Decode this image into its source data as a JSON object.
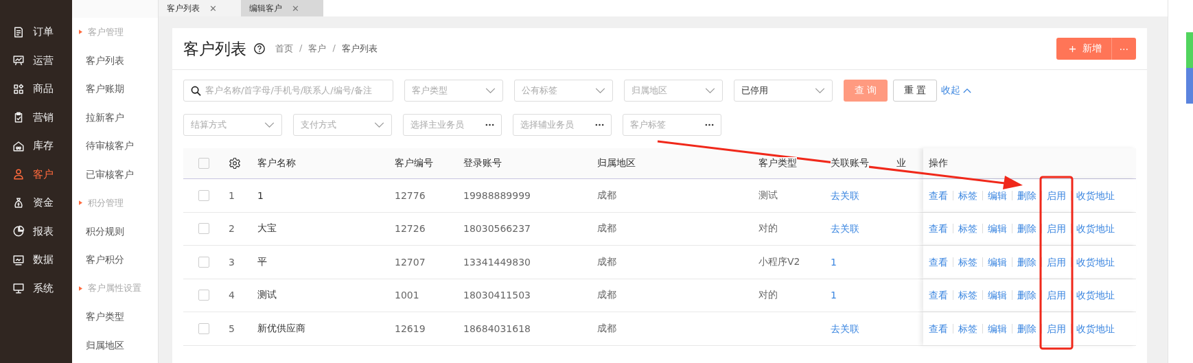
{
  "nav": [
    {
      "label": "订单",
      "selected": false
    },
    {
      "label": "运营",
      "selected": false
    },
    {
      "label": "商品",
      "selected": false
    },
    {
      "label": "营销",
      "selected": false
    },
    {
      "label": "库存",
      "selected": false
    },
    {
      "label": "客户",
      "selected": true
    },
    {
      "label": "资金",
      "selected": false
    },
    {
      "label": "报表",
      "selected": false
    },
    {
      "label": "数据",
      "selected": false
    },
    {
      "label": "系统",
      "selected": false
    }
  ],
  "submenu": [
    {
      "kind": "group",
      "label": "客户管理"
    },
    {
      "kind": "item",
      "label": "客户列表"
    },
    {
      "kind": "item",
      "label": "客户账期"
    },
    {
      "kind": "item",
      "label": "拉新客户"
    },
    {
      "kind": "item",
      "label": "待审核客户"
    },
    {
      "kind": "item",
      "label": "已审核客户"
    },
    {
      "kind": "group",
      "label": "积分管理"
    },
    {
      "kind": "item",
      "label": "积分规则"
    },
    {
      "kind": "item",
      "label": "客户积分"
    },
    {
      "kind": "group",
      "label": "客户属性设置"
    },
    {
      "kind": "item",
      "label": "客户类型"
    },
    {
      "kind": "item",
      "label": "归属地区"
    }
  ],
  "tabs": [
    {
      "label": "客户列表",
      "selected": true,
      "close": "✕"
    },
    {
      "label": "编辑客户",
      "selected": false,
      "close": "✕"
    }
  ],
  "page": {
    "title": "客户列表",
    "breadcrumb": [
      "首页",
      "客户",
      "客户列表"
    ],
    "separator": "/",
    "add_button": "新增",
    "more_button": "⋯"
  },
  "filters": [
    [
      {
        "kind": "search",
        "placeholder": "客户名称/首字母/手机号/联系人/编号/备注"
      },
      {
        "kind": "select",
        "placeholder": "客户类型"
      },
      {
        "kind": "select",
        "placeholder": "公有标签"
      },
      {
        "kind": "select",
        "placeholder": "归属地区"
      },
      {
        "kind": "select",
        "value": "已停用"
      }
    ],
    [
      {
        "kind": "select",
        "placeholder": "结算方式"
      },
      {
        "kind": "select",
        "placeholder": "支付方式"
      },
      {
        "kind": "picker",
        "placeholder": "选择主业务员"
      },
      {
        "kind": "picker",
        "placeholder": "选择辅业务员"
      },
      {
        "kind": "picker",
        "placeholder": "客户标签"
      }
    ]
  ],
  "filter_buttons": {
    "query": "查 询",
    "reset": "重 置",
    "collapse": "收起"
  },
  "table": {
    "all_checked": false,
    "columns": [
      "客户名称",
      "客户编号",
      "登录账号",
      "归属地区",
      "客户类型",
      "关联账号",
      "业",
      "操作"
    ],
    "rows": [
      {
        "index": "1",
        "checked": false,
        "name": "1",
        "code": "12776",
        "login": "19988889999",
        "region": "成都",
        "type": "测试",
        "linked": "去关联",
        "actions": [
          "查看",
          "标签",
          "编辑",
          "删除",
          "启用",
          "收货地址"
        ]
      },
      {
        "index": "2",
        "checked": false,
        "name": "大宝",
        "code": "12726",
        "login": "18030566237",
        "region": "成都",
        "type": "对的",
        "linked": "去关联",
        "actions": [
          "查看",
          "标签",
          "编辑",
          "删除",
          "启用",
          "收货地址"
        ]
      },
      {
        "index": "3",
        "checked": false,
        "name": "平",
        "code": "12707",
        "login": "13341449830",
        "region": "成都",
        "type": "小程序V2",
        "linked": "1",
        "actions": [
          "查看",
          "标签",
          "编辑",
          "删除",
          "启用",
          "收货地址"
        ]
      },
      {
        "index": "4",
        "checked": false,
        "name": "测试",
        "code": "1001",
        "login": "18030411503",
        "region": "成都",
        "type": "对的",
        "linked": "1",
        "actions": [
          "查看",
          "标签",
          "编辑",
          "删除",
          "启用",
          "收货地址"
        ]
      },
      {
        "index": "5",
        "checked": false,
        "name": "新优供应商",
        "code": "12619",
        "login": "18684031618",
        "region": "成都",
        "linked": "去关联",
        "actions": [
          "查看",
          "标签",
          "编辑",
          "删除",
          "启用",
          "收货地址"
        ]
      }
    ]
  },
  "annotation": {
    "arrow": true,
    "frame": true
  }
}
